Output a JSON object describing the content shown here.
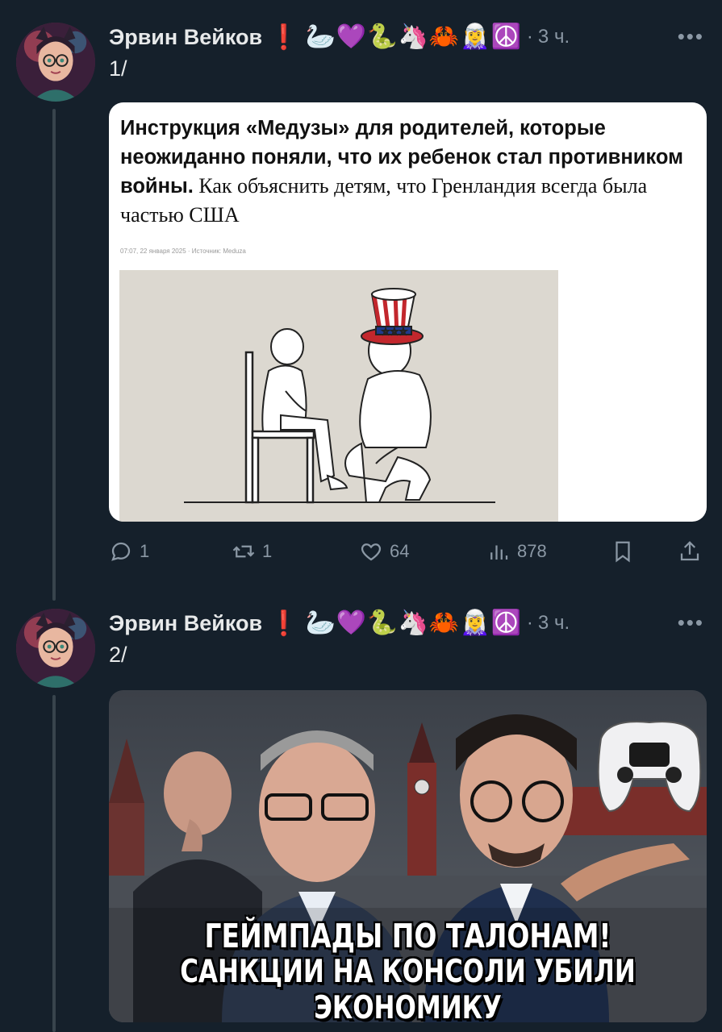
{
  "posts": [
    {
      "author": "Эрвин Вейков",
      "badges": "🦢💜🐍🦄🦀🧝‍♀️☮️",
      "badge_alert": "❗",
      "time": "3 ч.",
      "text": "1/",
      "card": {
        "title_bold": "Инструкция «Медузы» для родителей, которые неожиданно поняли, что их ребенок стал противником войны.",
        "title_serif": " Как объяснить детям, что Гренландия всегда была частью США",
        "meta": "07:07, 22 января 2025 · Источник: Meduza"
      },
      "actions": {
        "replies": "1",
        "reposts": "1",
        "likes": "64",
        "views": "878"
      }
    },
    {
      "author": "Эрвин Вейков",
      "badges": "🦢💜🐍🦄🦀🧝‍♀️☮️",
      "badge_alert": "❗",
      "time": "3 ч.",
      "text": "2/",
      "thumbnail": {
        "caption_line1": "ГЕЙМПАДЫ ПО ТАЛОНАМ!",
        "caption_line2": "САНКЦИИ НА КОНСОЛИ УБИЛИ ЭКОНОМИКУ"
      }
    }
  ],
  "icons": {
    "reply": "speech-bubble",
    "repost": "repost-arrows",
    "like": "heart",
    "views": "bar-chart",
    "bookmark": "bookmark",
    "share": "upload-arrow",
    "more": "ellipsis"
  },
  "colors": {
    "background": "#15202b",
    "text": "#e7e9ea",
    "muted": "#8b98a5",
    "thread_line": "#38444d"
  }
}
